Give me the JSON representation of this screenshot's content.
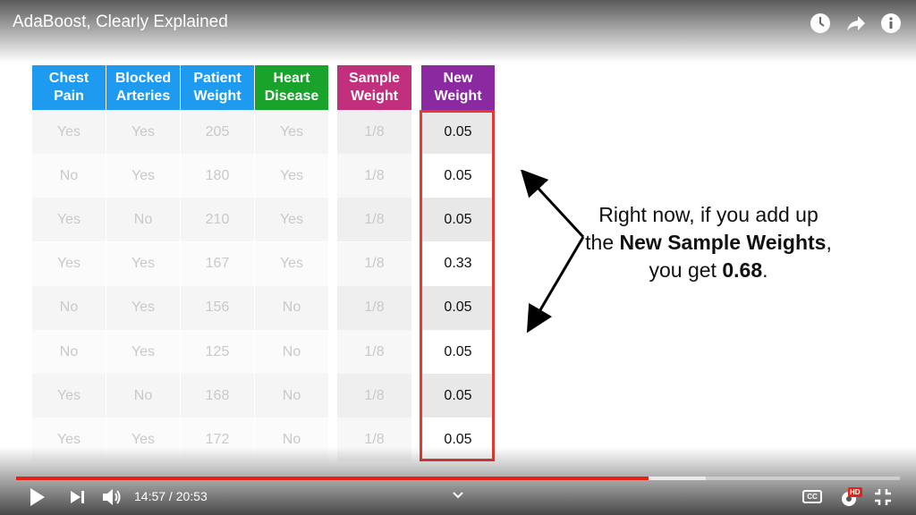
{
  "player": {
    "title": "AdaBoost, Clearly Explained",
    "time_current": "14:57",
    "time_separator": " / ",
    "time_total": "20:53",
    "progress_fraction": 0.716,
    "buffer_fraction": 0.78,
    "quality_badge": "HD",
    "cc_label": "CC",
    "accent_color": "#e62117",
    "top_icons": [
      "clock-icon",
      "share-icon",
      "info-icon"
    ],
    "bottom_icons": [
      "play-icon",
      "next-icon",
      "volume-icon",
      "chevron-down-icon",
      "cc-icon",
      "settings-icon",
      "exit-fullscreen-icon"
    ]
  },
  "table": {
    "headers": [
      {
        "label": "Chest\nPain",
        "color": "#1e9bf0"
      },
      {
        "label": "Blocked\nArteries",
        "color": "#1e9bf0"
      },
      {
        "label": "Patient\nWeight",
        "color": "#1e9bf0"
      },
      {
        "label": "Heart\nDisease",
        "color": "#1aa32b"
      },
      {
        "label": "Sample\nWeight",
        "color": "#c2307d"
      },
      {
        "label": "New\nWeight",
        "color": "#8b2aa0"
      }
    ],
    "rows": [
      [
        "Yes",
        "Yes",
        "205",
        "Yes",
        "1/8",
        "0.05"
      ],
      [
        "No",
        "Yes",
        "180",
        "Yes",
        "1/8",
        "0.05"
      ],
      [
        "Yes",
        "No",
        "210",
        "Yes",
        "1/8",
        "0.05"
      ],
      [
        "Yes",
        "Yes",
        "167",
        "Yes",
        "1/8",
        "0.33"
      ],
      [
        "No",
        "Yes",
        "156",
        "No",
        "1/8",
        "0.05"
      ],
      [
        "No",
        "Yes",
        "125",
        "No",
        "1/8",
        "0.05"
      ],
      [
        "Yes",
        "No",
        "168",
        "No",
        "1/8",
        "0.05"
      ],
      [
        "Yes",
        "Yes",
        "172",
        "No",
        "1/8",
        "0.05"
      ]
    ]
  },
  "note": {
    "part1": "Right now, if you add up the ",
    "bold1": "New Sample Weights",
    "part2": ", you get ",
    "bold2": "0.68",
    "part3": "."
  }
}
